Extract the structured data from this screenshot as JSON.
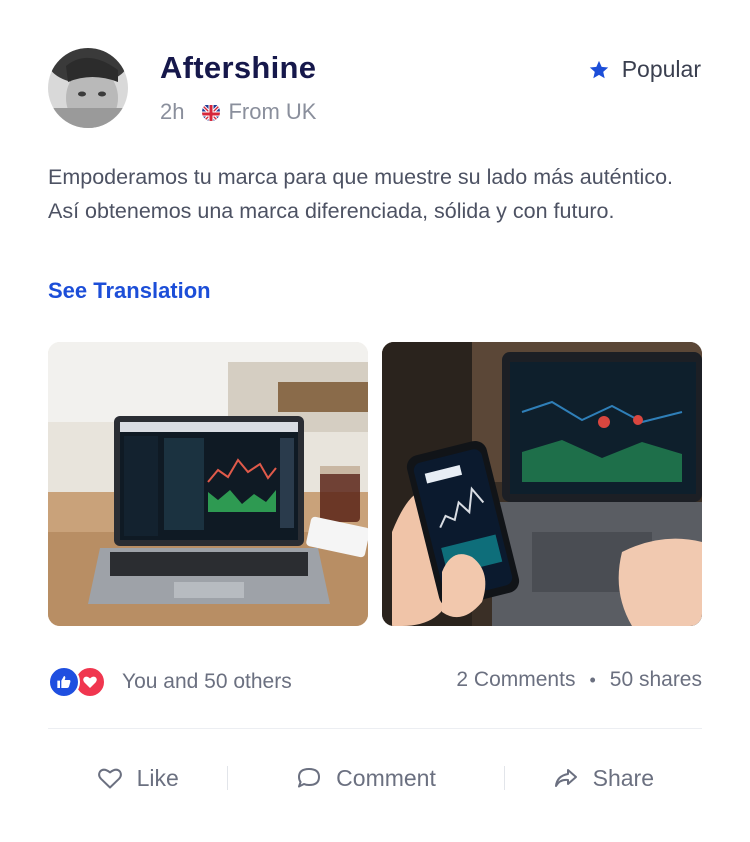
{
  "post": {
    "author": "Aftershine",
    "time": "2h",
    "origin": "From UK",
    "badge": "Popular",
    "text": "Empoderamos tu marca para que muestre su lado más auténtico. Así obtenemos una marca diferenciada, sólida y con futuro.",
    "translate_link": "See Translation"
  },
  "engagement": {
    "reactions_text": "You and 50 others",
    "comments": "2 Comments",
    "separator": "•",
    "shares": "50 shares"
  },
  "actions": {
    "like": "Like",
    "comment": "Comment",
    "share": "Share"
  },
  "icons": {
    "badge": "star-icon",
    "flag": "uk-flag-icon",
    "like": "heart-outline-icon",
    "comment": "speech-bubble-icon",
    "share": "share-arrow-icon"
  },
  "colors": {
    "accent": "#1c4ed8",
    "author": "#16184b",
    "like_reaction": "#1f4fe0",
    "love_reaction": "#f0364f"
  }
}
